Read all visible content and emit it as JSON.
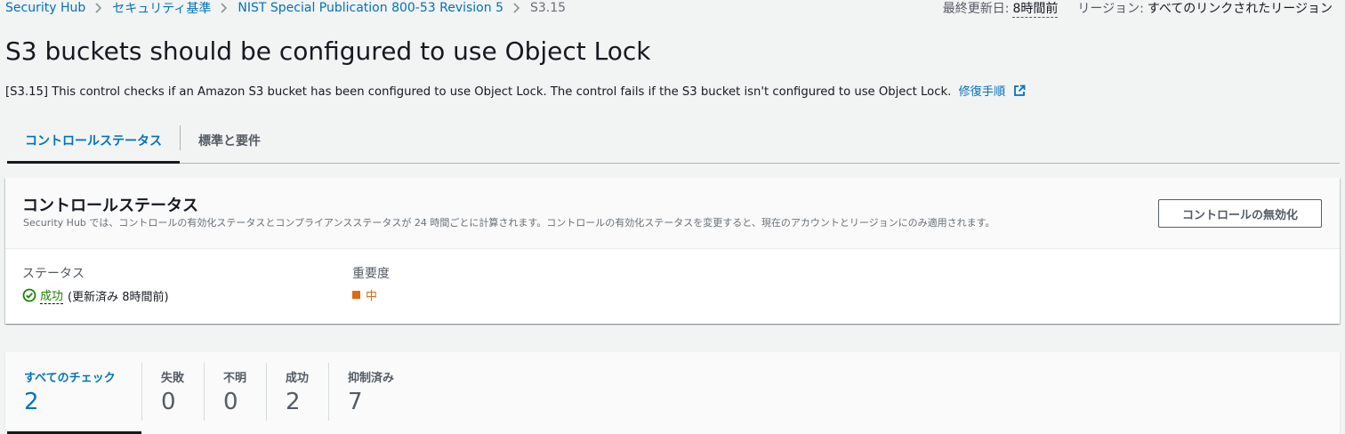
{
  "breadcrumb": {
    "items": [
      "Security Hub",
      "セキュリティ基準",
      "NIST Special Publication 800-53 Revision 5"
    ],
    "current": "S3.15"
  },
  "topright": {
    "last_updated_label": "最終更新日:",
    "last_updated_value": "8時間前",
    "region_label": "リージョン:",
    "region_value": "すべてのリンクされたリージョン"
  },
  "page": {
    "title": "S3 buckets should be configured to use Object Lock",
    "description": "[S3.15] This control checks if an Amazon S3 bucket has been configured to use Object Lock. The control fails if the S3 bucket isn't configured to use Object Lock.",
    "remediation_link": "修復手順"
  },
  "tabs": [
    {
      "label": "コントロールステータス",
      "active": true
    },
    {
      "label": "標準と要件",
      "active": false
    }
  ],
  "status_panel": {
    "title": "コントロールステータス",
    "subtitle": "Security Hub では、コントロールの有効化ステータスとコンプライアンスステータスが 24 時間ごとに計算されます。コントロールの有効化ステータスを変更すると、現在のアカウントとリージョンにのみ適用されます。",
    "disable_button": "コントロールの無効化",
    "status_label": "ステータス",
    "status_value": "成功",
    "status_note": "(更新済み 8時間前)",
    "severity_label": "重要度",
    "severity_value": "中"
  },
  "checks": [
    {
      "label": "すべてのチェック",
      "count": "2",
      "active": true
    },
    {
      "label": "失敗",
      "count": "0",
      "active": false
    },
    {
      "label": "不明",
      "count": "0",
      "active": false
    },
    {
      "label": "成功",
      "count": "2",
      "active": false
    },
    {
      "label": "抑制済み",
      "count": "7",
      "active": false
    }
  ],
  "colors": {
    "link": "#0073bb",
    "success": "#1d8102",
    "severity_medium": "#dd6b10",
    "background": "#f2f3f3"
  }
}
